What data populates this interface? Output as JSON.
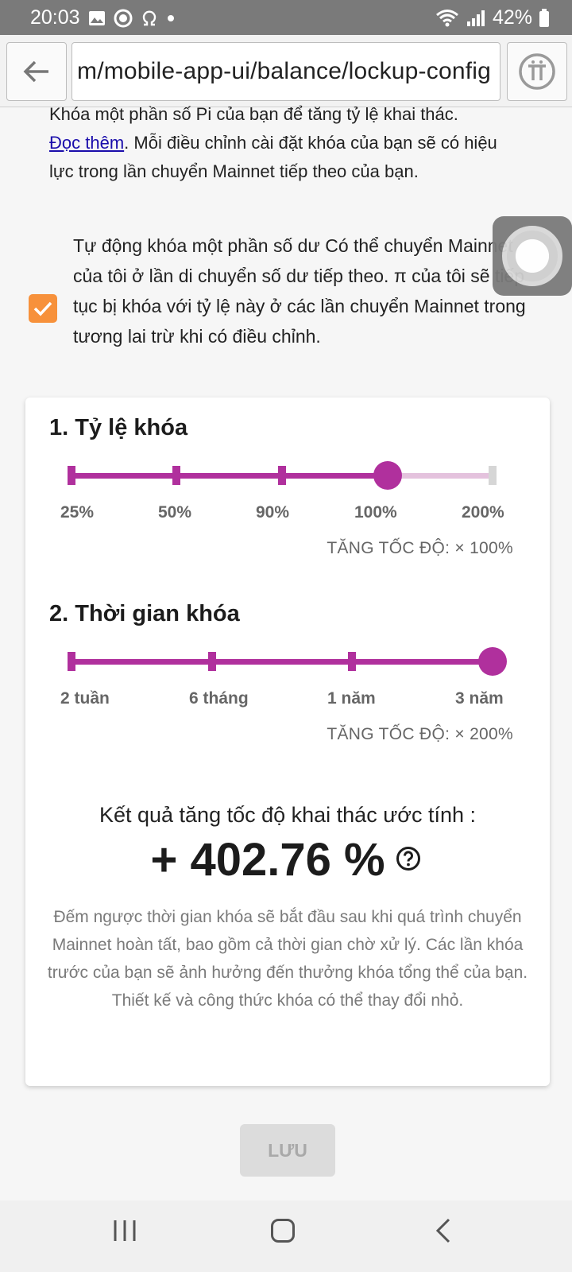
{
  "status_bar": {
    "time": "20:03",
    "battery": "42%"
  },
  "browser": {
    "url": "m/mobile-app-ui/balance/lockup-config"
  },
  "intro": {
    "line1": "Khóa một phần số Pi của bạn để tăng tỷ lệ khai thác.",
    "read_more": "Đọc thêm",
    "rest": ". Mỗi điều chỉnh cài đặt khóa của bạn sẽ có hiệu lực trong lần chuyển Mainnet tiếp theo của bạn."
  },
  "auto_lock": {
    "checked": true,
    "text": "Tự động khóa một phần số dư Có thể chuyển Mainnet của tôi ở lần di chuyển số dư tiếp theo. π của tôi sẽ tiếp tục bị khóa với tỷ lệ này ở các lần chuyển Mainnet trong tương lai trừ khi có điều chỉnh."
  },
  "lock_ratio": {
    "title": "1. Tỷ lệ khóa",
    "options": [
      "25%",
      "50%",
      "90%",
      "100%",
      "200%"
    ],
    "selected_index": 3,
    "boost": "TĂNG TỐC ĐỘ: × 100%"
  },
  "lock_time": {
    "title": "2. Thời gian khóa",
    "options": [
      "2 tuần",
      "6 tháng",
      "1 năm",
      "3 năm"
    ],
    "selected_index": 3,
    "boost": "TĂNG TỐC ĐỘ: × 200%"
  },
  "result": {
    "title": "Kết quả tăng tốc độ khai thác ước tính :",
    "value": "+ 402.76 %",
    "note": "Đếm ngược thời gian khóa sẽ bắt đầu sau khi quá trình chuyển Mainnet hoàn tất, bao gồm cả thời gian chờ xử lý. Các lần khóa trước của bạn sẽ ảnh hưởng đến thưởng khóa tổng thể của bạn. Thiết kế và công thức khóa có thể thay đổi nhỏ."
  },
  "save_label": "LƯU",
  "colors": {
    "accent": "#b0309d",
    "checkbox": "#f7913b"
  }
}
